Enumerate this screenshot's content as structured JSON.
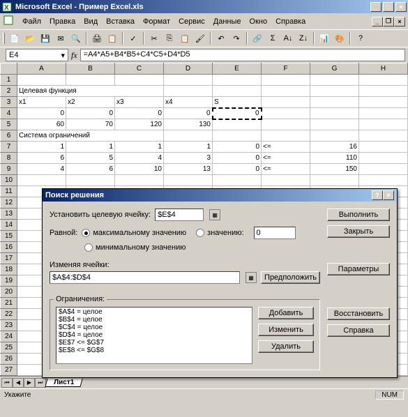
{
  "title": "Microsoft Excel - Пример Excel.xls",
  "menu": [
    "Файл",
    "Правка",
    "Вид",
    "Вставка",
    "Формат",
    "Сервис",
    "Данные",
    "Окно",
    "Справка"
  ],
  "namebox": "E4",
  "formula": "=A4*A5+B4*B5+C4*C5+D4*D5",
  "cols": [
    "A",
    "B",
    "C",
    "D",
    "E",
    "F",
    "G",
    "H"
  ],
  "rows": {
    "2": {
      "A": "Целевая функция"
    },
    "3": {
      "A": "x1",
      "B": "x2",
      "C": "x3",
      "D": "x4",
      "E": "S"
    },
    "4": {
      "A": "0",
      "B": "0",
      "C": "0",
      "D": "0",
      "E": "0"
    },
    "5": {
      "A": "60",
      "B": "70",
      "C": "120",
      "D": "130"
    },
    "6": {
      "A": "Система ограничений"
    },
    "7": {
      "A": "1",
      "B": "1",
      "C": "1",
      "D": "1",
      "E": "0",
      "F": "<=",
      "G": "16"
    },
    "8": {
      "A": "6",
      "B": "5",
      "C": "4",
      "D": "3",
      "E": "0",
      "F": "<=",
      "G": "110"
    },
    "9": {
      "A": "4",
      "B": "6",
      "C": "10",
      "D": "13",
      "E": "0",
      "F": "<=",
      "G": "150"
    }
  },
  "dialog": {
    "title": "Поиск решения",
    "target_label": "Установить целевую ячейку:",
    "target_value": "$E$4",
    "equal_label": "Равной:",
    "opt_max": "максимальному значению",
    "opt_val": "значению:",
    "opt_val_value": "0",
    "opt_min": "минимальному значению",
    "changing_label": "Изменяя ячейки:",
    "changing_value": "$A$4:$D$4",
    "guess": "Предположить",
    "constraints_label": "Ограничения:",
    "constraints": [
      "$A$4 = целое",
      "$B$4 = целое",
      "$C$4 = целое",
      "$D$4 = целое",
      "$E$7 <= $G$7",
      "$E$8 <= $G$8"
    ],
    "btn_execute": "Выполнить",
    "btn_close": "Закрыть",
    "btn_params": "Параметры",
    "btn_add": "Добавить",
    "btn_edit": "Изменить",
    "btn_delete": "Удалить",
    "btn_restore": "Восстановить",
    "btn_help": "Справка"
  },
  "sheet_tab": "Лист1",
  "status": "Укажите",
  "status_num": "NUM"
}
